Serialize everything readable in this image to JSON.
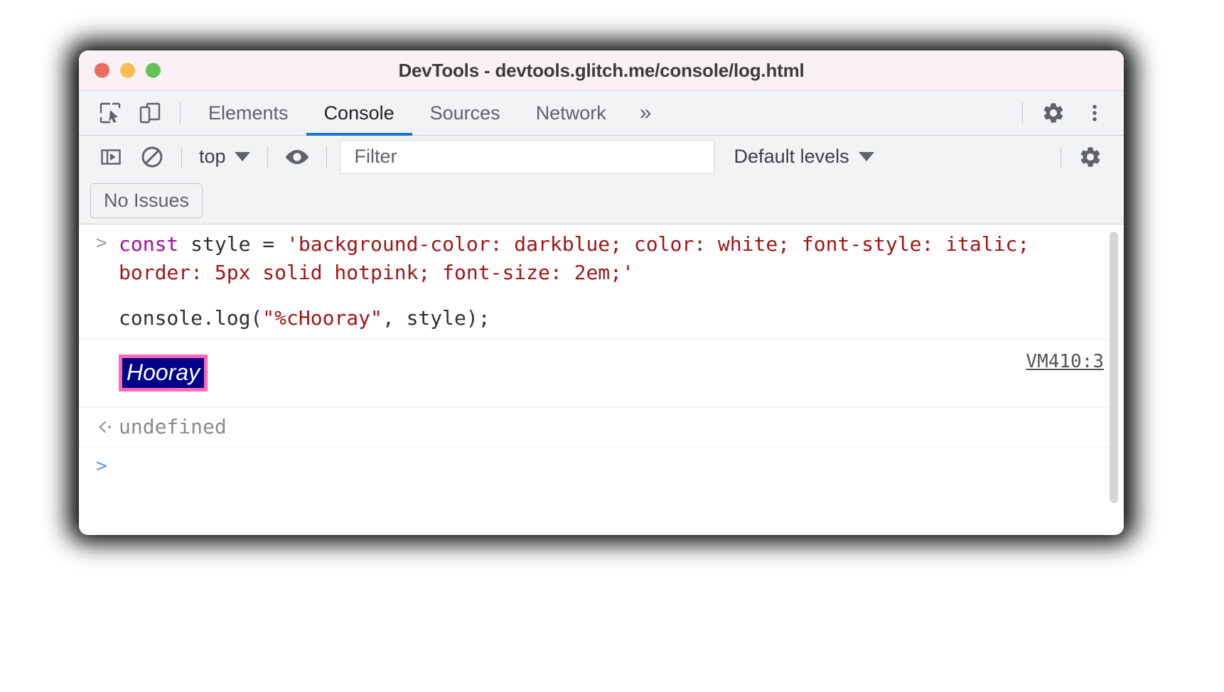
{
  "window": {
    "title": "DevTools - devtools.glitch.me/console/log.html",
    "traffic_lights": [
      "close-red",
      "minimize-yellow",
      "maximize-green"
    ]
  },
  "tabbar": {
    "icons": [
      {
        "name": "inspect-element-icon",
        "label": "Inspect element"
      },
      {
        "name": "device-toolbar-icon",
        "label": "Toggle device toolbar"
      }
    ],
    "tabs": [
      {
        "label": "Elements",
        "active": false
      },
      {
        "label": "Console",
        "active": true
      },
      {
        "label": "Sources",
        "active": false
      },
      {
        "label": "Network",
        "active": false
      }
    ],
    "more_tabs_label": "»",
    "settings_label": "Settings",
    "menu_label": "Customize and control DevTools",
    "active_tab_underline_color": "#1a73e8"
  },
  "console_toolbar": {
    "sidebar_toggle_label": "Show console sidebar",
    "clear_console_label": "Clear console",
    "context_selector": {
      "value": "top",
      "caret": "▼"
    },
    "live_expression_label": "Create live expression",
    "filter": {
      "value": "",
      "placeholder": "Filter"
    },
    "levels": {
      "value": "Default levels",
      "caret": "▼"
    },
    "settings_label": "Console settings"
  },
  "issues": {
    "button_label": "No Issues"
  },
  "console": {
    "rows": [
      {
        "type": "input",
        "gutter": ">",
        "statement_1": {
          "keyword": "const",
          "middle": " style = ",
          "string": "'background-color: darkblue; color: white; font-style: italic; border: 5px solid hotpink; font-size: 2em;'"
        },
        "statement_2": {
          "before": "console.log(",
          "string": "\"%cHooray\"",
          "after": ", style);"
        }
      },
      {
        "type": "output",
        "text": "Hooray",
        "source_link": "VM410:3",
        "style": {
          "background-color": "#00008b",
          "color": "#ffffff",
          "font-style": "italic",
          "border": "5px solid #ff69b4",
          "font-size": "2em"
        }
      },
      {
        "type": "return",
        "gutter": "‹·",
        "text": "undefined"
      },
      {
        "type": "prompt",
        "gutter": ">",
        "text": ""
      }
    ]
  },
  "colors": {
    "accent": "#1a73e8",
    "titlebar_bg": "#f9f1f6",
    "toolbar_bg": "#f1f3f4",
    "keyword": "#a80aa8",
    "string": "#a31515",
    "hooray_bg": "#00008b",
    "hooray_border": "#ff69b4"
  }
}
